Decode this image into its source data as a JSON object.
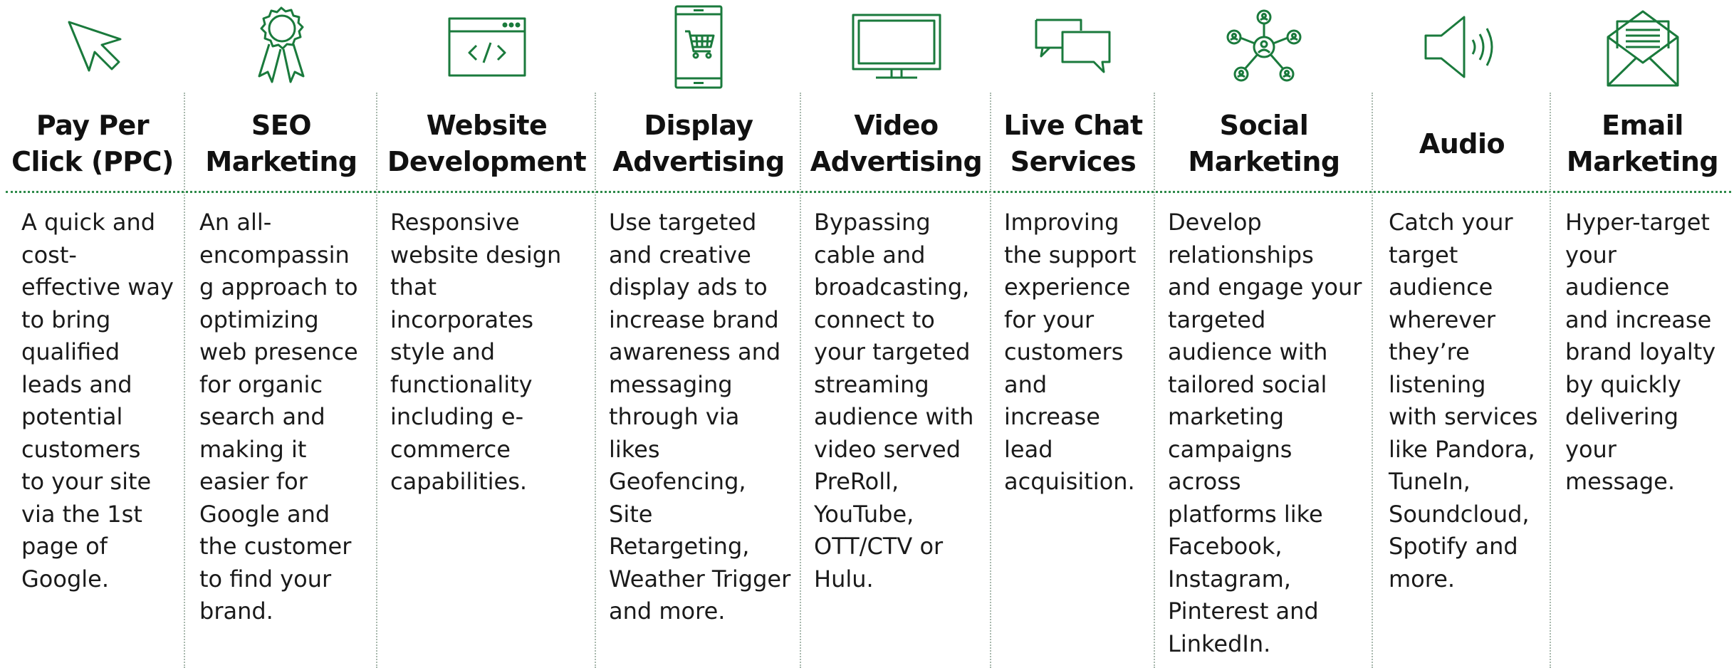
{
  "colors": {
    "accent": "#1a7a3c",
    "text": "#111111",
    "rule": "#2e8a4a"
  },
  "services": [
    {
      "id": "ppc",
      "icon": "cursor-arrow-icon",
      "title_lines": [
        "Pay Per",
        "Click (PPC)"
      ],
      "description": "A quick and\ncost-\neffective way\nto bring\nqualified\nleads and\npotential\ncustomers\nto your site\nvia the 1st\npage of\nGoogle."
    },
    {
      "id": "seo",
      "icon": "award-ribbon-icon",
      "title_lines": [
        "SEO",
        "Marketing"
      ],
      "description": "An all-\nencompassin\ng approach to\noptimizing\nweb presence\nfor organic\nsearch and\nmaking it\neasier for\nGoogle and\nthe customer\nto find your\nbrand."
    },
    {
      "id": "web",
      "icon": "code-browser-icon",
      "title_lines": [
        "Website",
        "Development"
      ],
      "description": "Responsive\nwebsite design\nthat\nincorporates\nstyle and\nfunctionality\nincluding e-\ncommerce\ncapabilities."
    },
    {
      "id": "display",
      "icon": "mobile-shopping-cart-icon",
      "title_lines": [
        "Display",
        "Advertising"
      ],
      "description": "Use targeted\nand creative\ndisplay ads to\nincrease brand\nawareness and\nmessaging\nthrough via\nlikes\nGeofencing,\nSite\nRetargeting,\nWeather Trigger\nand more."
    },
    {
      "id": "video",
      "icon": "television-icon",
      "title_lines": [
        "Video",
        "Advertising"
      ],
      "description": "Bypassing\ncable and\nbroadcasting,\nconnect to\nyour targeted\nstreaming\naudience with\nvideo served\nPreRoll,\nYouTube,\nOTT/CTV or\nHulu."
    },
    {
      "id": "chat",
      "icon": "chat-bubbles-icon",
      "title_lines": [
        "Live Chat",
        "Services"
      ],
      "description": "Improving\nthe support\nexperience\nfor your\ncustomers\nand\nincrease\nlead\nacquisition."
    },
    {
      "id": "social",
      "icon": "social-network-icon",
      "title_lines": [
        "Social",
        "Marketing"
      ],
      "description": "Develop\nrelationships\nand engage your\ntargeted\naudience with\ntailored social\nmarketing\ncampaigns\nacross\nplatforms like\nFacebook,\nInstagram,\nPinterest and\nLinkedIn."
    },
    {
      "id": "audio",
      "icon": "speaker-sound-icon",
      "title_lines": [
        "Audio"
      ],
      "description": "Catch your\ntarget\naudience\nwherever\nthey’re\nlistening\nwith services\nlike Pandora,\nTuneIn,\nSoundcloud,\nSpotify and\nmore."
    },
    {
      "id": "email",
      "icon": "envelope-letter-icon",
      "title_lines": [
        "Email",
        "Marketing"
      ],
      "description": "Hyper-target\nyour\naudience\nand increase\nbrand loyalty\nby quickly\ndelivering\nyour\nmessage."
    }
  ]
}
